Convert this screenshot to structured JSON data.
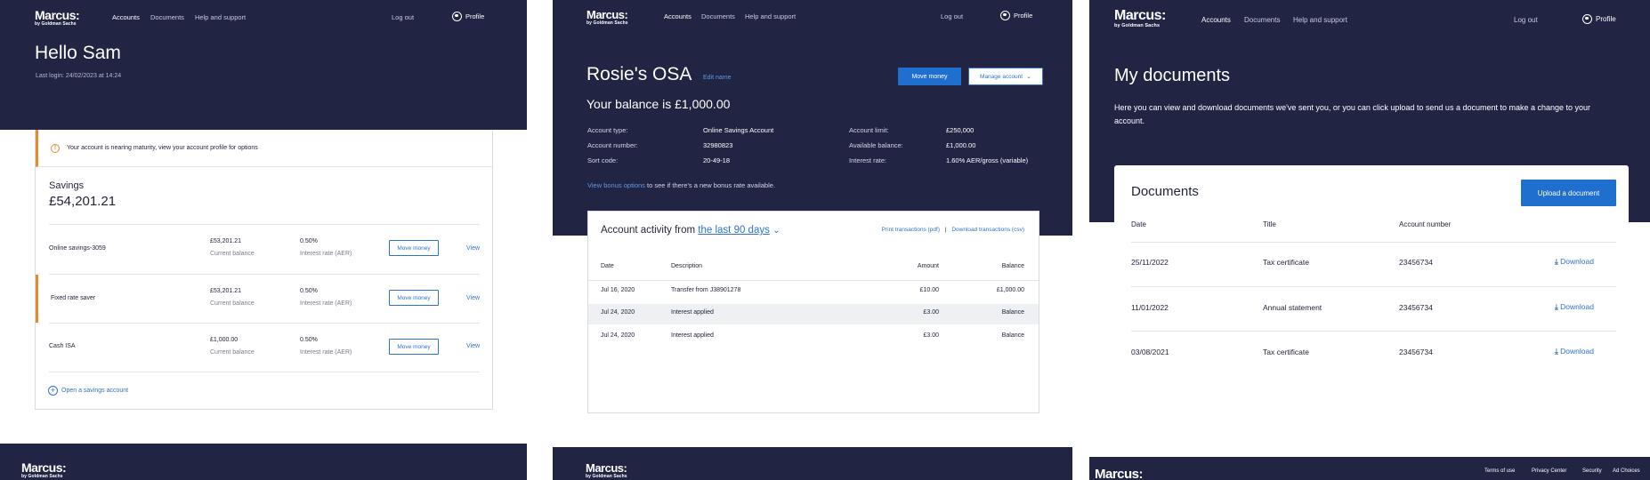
{
  "brand": {
    "wordmark": "Marcus:",
    "sub": "by Goldman Sachs"
  },
  "nav": {
    "accounts": "Accounts",
    "documents": "Documents",
    "help": "Help and support",
    "logout": "Log out",
    "profile": "Profile"
  },
  "panel1": {
    "greeting": "Hello Sam",
    "last_login": "Last login: 24/02/2023 at 14:24",
    "alert": "Your account is nearing maturity, view your account profile for options",
    "savings_label": "Savings",
    "savings_total": "£54,201.21",
    "accounts": [
      {
        "name": "Online savings-3059",
        "balance": "£53,201.21",
        "balance_label": "Current balance",
        "rate": "0.50%",
        "rate_label": "Interest rate (AER)",
        "move": "Move money",
        "view": "View"
      },
      {
        "name": "Fixed rate saver",
        "balance": "£53,201.21",
        "balance_label": "Current balance",
        "rate": "0.50%",
        "rate_label": "Interest rate (AER)",
        "move": "Move money",
        "view": "View"
      },
      {
        "name": "Cash ISA",
        "balance": "£1,000.00",
        "balance_label": "Current balance",
        "rate": "0.50%",
        "rate_label": "Interest rate (AER)",
        "move": "Move money",
        "view": "View"
      }
    ],
    "open_account": "Open a savings account"
  },
  "panel2": {
    "title": "Rosie's OSA",
    "edit_name": "Edit name",
    "move_money": "Move money",
    "manage_account": "Manage account",
    "balance": "Your balance is £1,000.00",
    "details_left": [
      {
        "label": "Account type:",
        "value": "Online Savings Account"
      },
      {
        "label": "Account number:",
        "value": "32980823"
      },
      {
        "label": "Sort code:",
        "value": "20-49-18"
      }
    ],
    "details_right": [
      {
        "label": "Account limit:",
        "value": "£250,000"
      },
      {
        "label": "Available balance:",
        "value": "£1,000.00"
      },
      {
        "label": "Interest rate:",
        "value": "1.60% AER/gross (variable)"
      }
    ],
    "bonus_link": "View bonus options",
    "bonus_text": " to see if there's a new bonus rate available.",
    "activity_prefix": "Account activity from",
    "activity_range": "the last 90 days",
    "print": "Print transactions (pdf)",
    "separator": "|",
    "download": "Download transactions (csv)",
    "columns": {
      "date": "Date",
      "description": "Description",
      "amount": "Amount",
      "balance": "Balance"
    },
    "rows": [
      {
        "date": "Jul 16, 2020",
        "description": "Transfer from J38901278",
        "amount": "£10.00",
        "balance": "£1,000.00"
      },
      {
        "date": "Jul 24, 2020",
        "description": "Interest applied",
        "amount": "£3.00",
        "balance": "Balance"
      },
      {
        "date": "Jul 24, 2020",
        "description": "Interest applied",
        "amount": "£3.00",
        "balance": "Balance"
      }
    ]
  },
  "panel3": {
    "title": "My documents",
    "intro": "Here you can view and download documents we've sent you, or you can click upload to send us a document to make a change to your account.",
    "card_title": "Documents",
    "upload": "Upload a document",
    "columns": {
      "date": "Date",
      "title": "Title",
      "account": "Account number"
    },
    "rows": [
      {
        "date": "25/11/2022",
        "title": "Tax certificate",
        "account": "23456734",
        "action": "Download"
      },
      {
        "date": "11/01/2022",
        "title": "Annual statement",
        "account": "23456734",
        "action": "Download"
      },
      {
        "date": "03/08/2021",
        "title": "Tax certificate",
        "account": "23456734",
        "action": "Download"
      }
    ]
  },
  "footer": {
    "terms": "Terms of use",
    "privacy": "Privacy Center",
    "security": "Security",
    "ad_choices": "Ad Choices"
  },
  "colors": {
    "navy": "#212443",
    "accent": "#2e73c9",
    "warning": "#e08b2c"
  }
}
